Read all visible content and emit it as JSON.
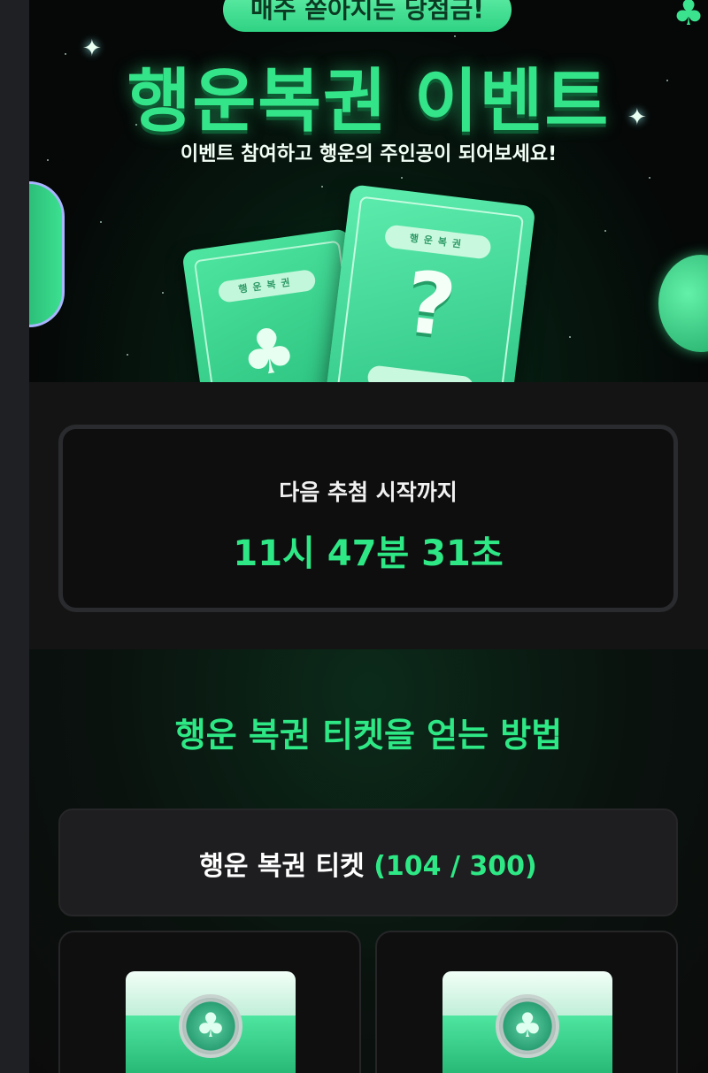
{
  "hero": {
    "top_badge": "매주 쏟아지는 당첨금!",
    "title": "행운복권 이벤트",
    "subtitle": "이벤트 참여하고 행운의 주인공이 되어보세요!",
    "card_label": "행운복권",
    "card_mark": "?"
  },
  "countdown": {
    "label": "다음 추첨 시작까지",
    "time": "11시 47분 31초"
  },
  "howto": {
    "title": "행운 복권 티켓을 얻는 방법",
    "ticket_label": "행운 복권 티켓",
    "ticket_count": "(104 / 300)"
  },
  "colors": {
    "accent": "#2ee885",
    "background": "#141414",
    "card": "#1e1e20"
  }
}
